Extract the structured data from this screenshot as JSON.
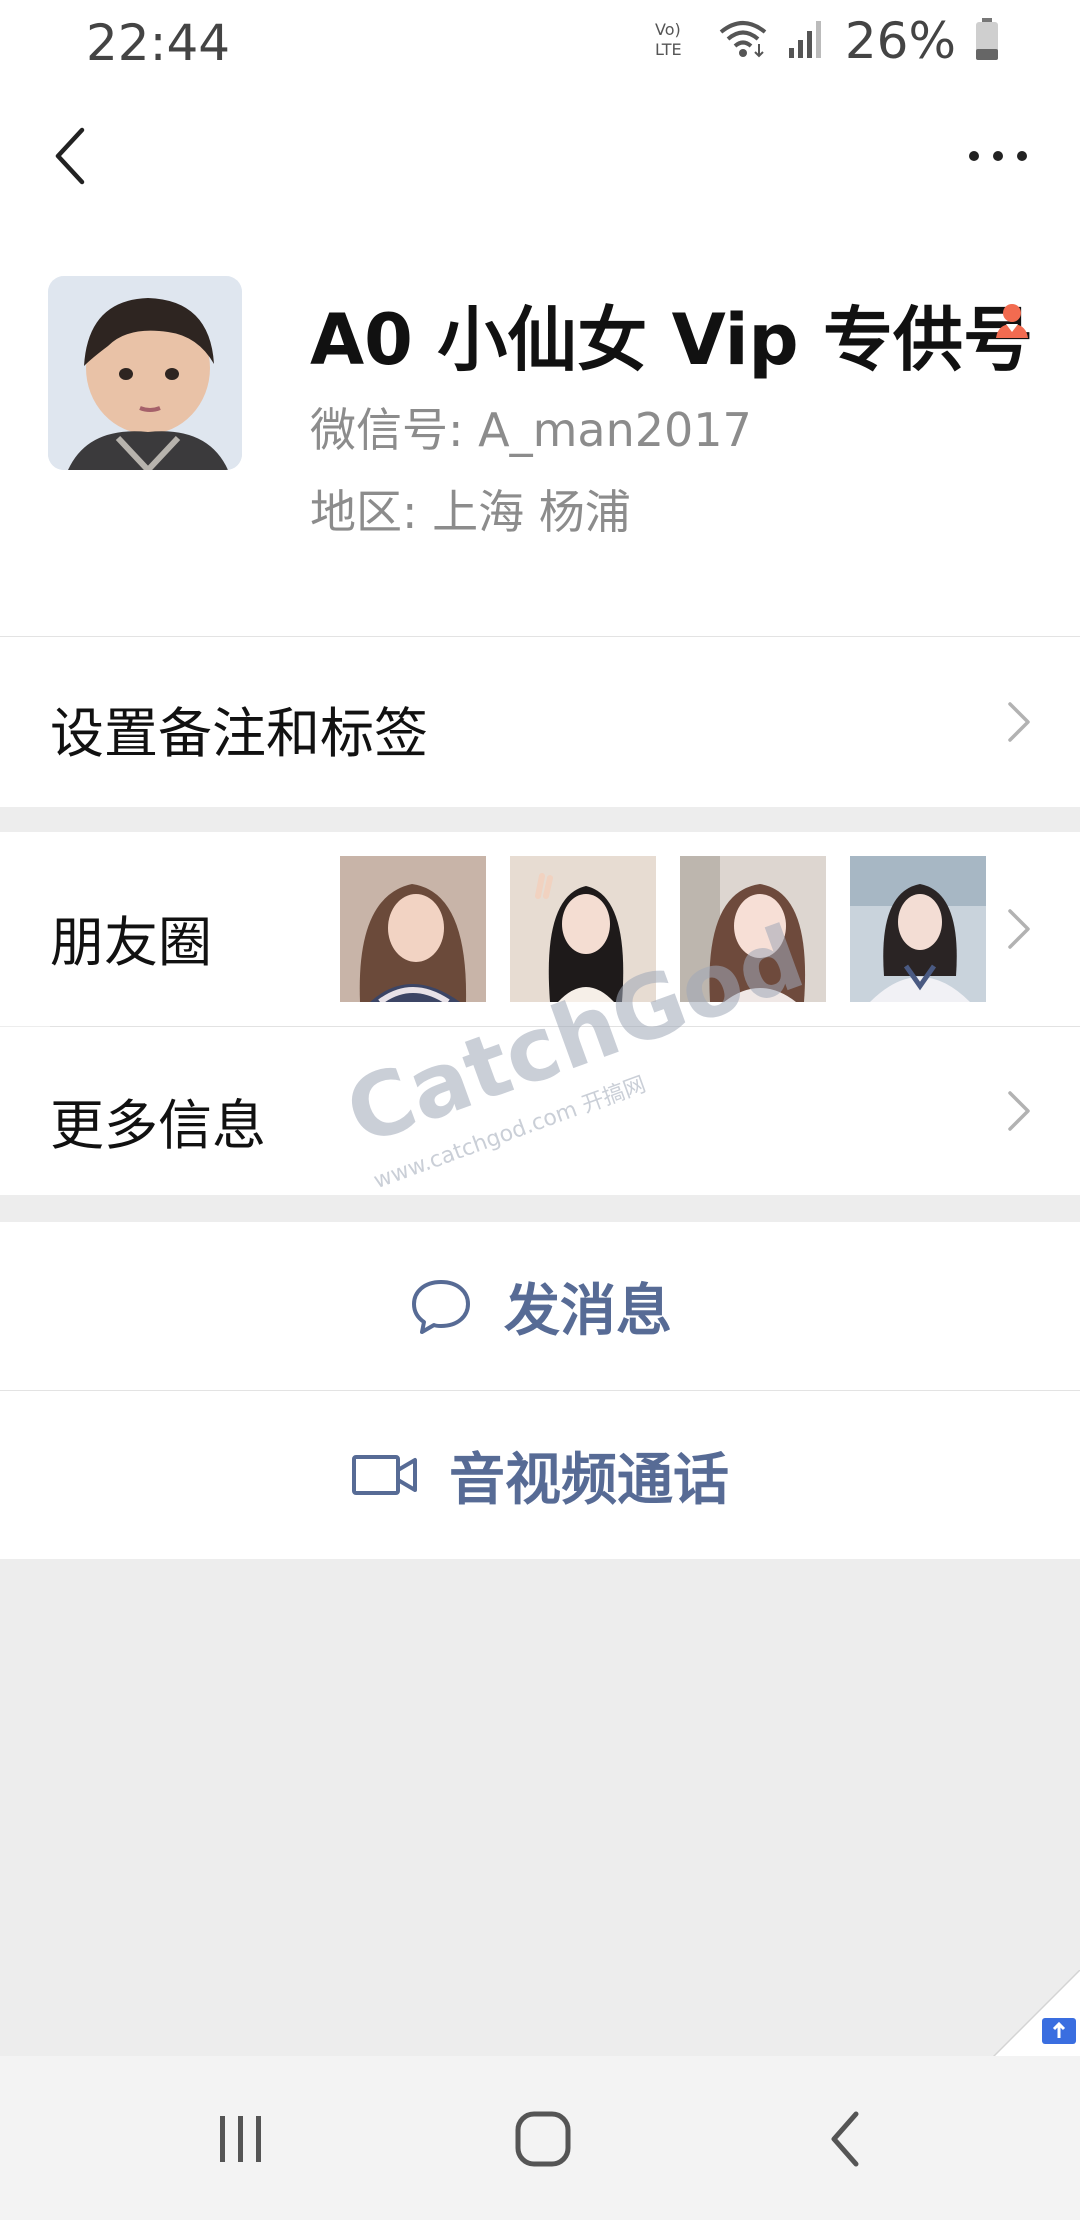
{
  "status_bar": {
    "time": "22:44",
    "battery": "26%",
    "network_label": "Vo) LTE",
    "icons": [
      "volte-icon",
      "wifi-icon",
      "signal-icon",
      "battery-icon"
    ]
  },
  "navbar": {
    "back_icon": "chevron-left-icon",
    "more_icon": "more-dots-icon"
  },
  "profile": {
    "name": "A0 小仙女 Vip 专供号",
    "gender_icon": "female-icon",
    "wechat_id": "微信号:  A_man2017",
    "region": "地区:  上海  杨浦"
  },
  "menu": {
    "remark_tags": "设置备注和标签",
    "moments": "朋友圈",
    "more_info": "更多信息"
  },
  "actions": {
    "send_message": "发消息",
    "video_call": "音视频通话"
  },
  "watermark": {
    "brand": "CatchGod",
    "sub": "www.catchgod.com 开搞网"
  },
  "colors": {
    "link_blue": "#576b95",
    "female_orange": "#f26b50",
    "background": "#ededed"
  }
}
